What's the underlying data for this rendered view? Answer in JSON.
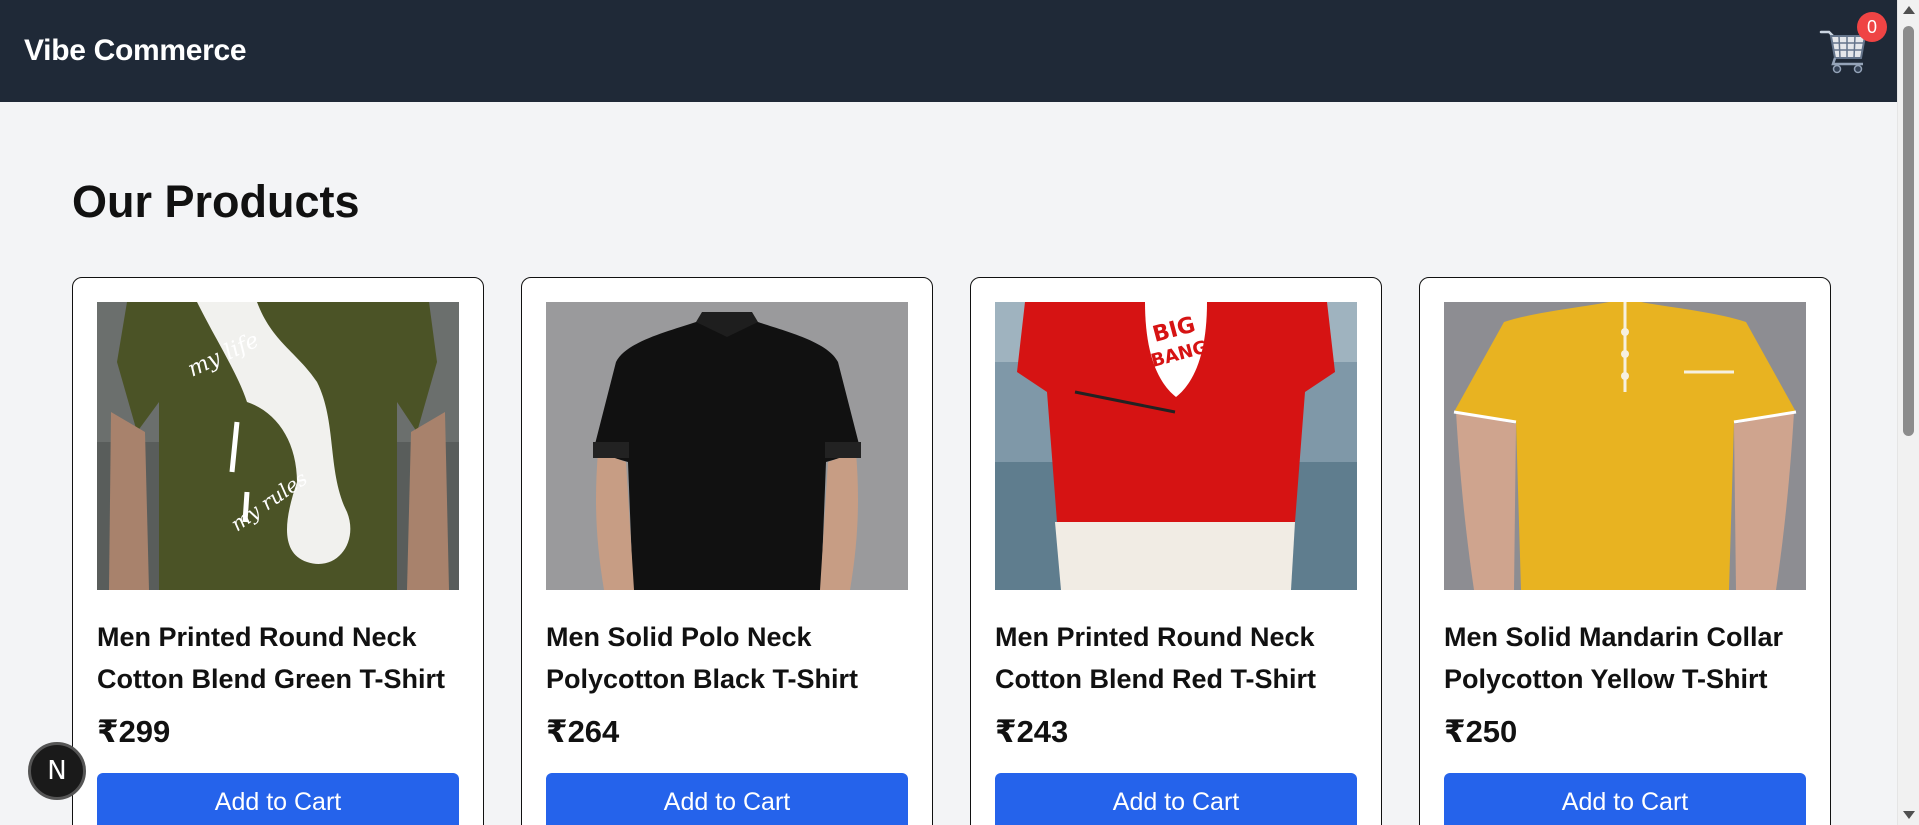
{
  "header": {
    "brand": "Vibe Commerce",
    "cart_count": "0",
    "cart_icon": "shopping-cart-icon"
  },
  "main": {
    "title": "Our Products",
    "products": [
      {
        "name": "Men Printed Round Neck Cotton Blend Green T-Shirt",
        "price": "₹299",
        "button": "Add to Cart",
        "shirt_color": "#4b5326",
        "background_color": "#5f6260"
      },
      {
        "name": "Men Solid Polo Neck Polycotton Black T-Shirt",
        "price": "₹264",
        "button": "Add to Cart",
        "shirt_color": "#111111",
        "background_color": "#9a9a9c"
      },
      {
        "name": "Men Printed Round Neck Cotton Blend Red T-Shirt",
        "price": "₹243",
        "button": "Add to Cart",
        "shirt_color": "#d61313",
        "background_color": "#7f98a8"
      },
      {
        "name": "Men Solid Mandarin Collar Polycotton Yellow T-Shirt",
        "price": "₹250",
        "button": "Add to Cart",
        "shirt_color": "#e8b321",
        "background_color": "#8d8d92"
      }
    ]
  },
  "dev_badge": {
    "letter": "N"
  },
  "colors": {
    "navbar": "#1f2937",
    "accent": "#2563eb",
    "badge": "#ef4444",
    "page_background": "#f3f4f6"
  }
}
